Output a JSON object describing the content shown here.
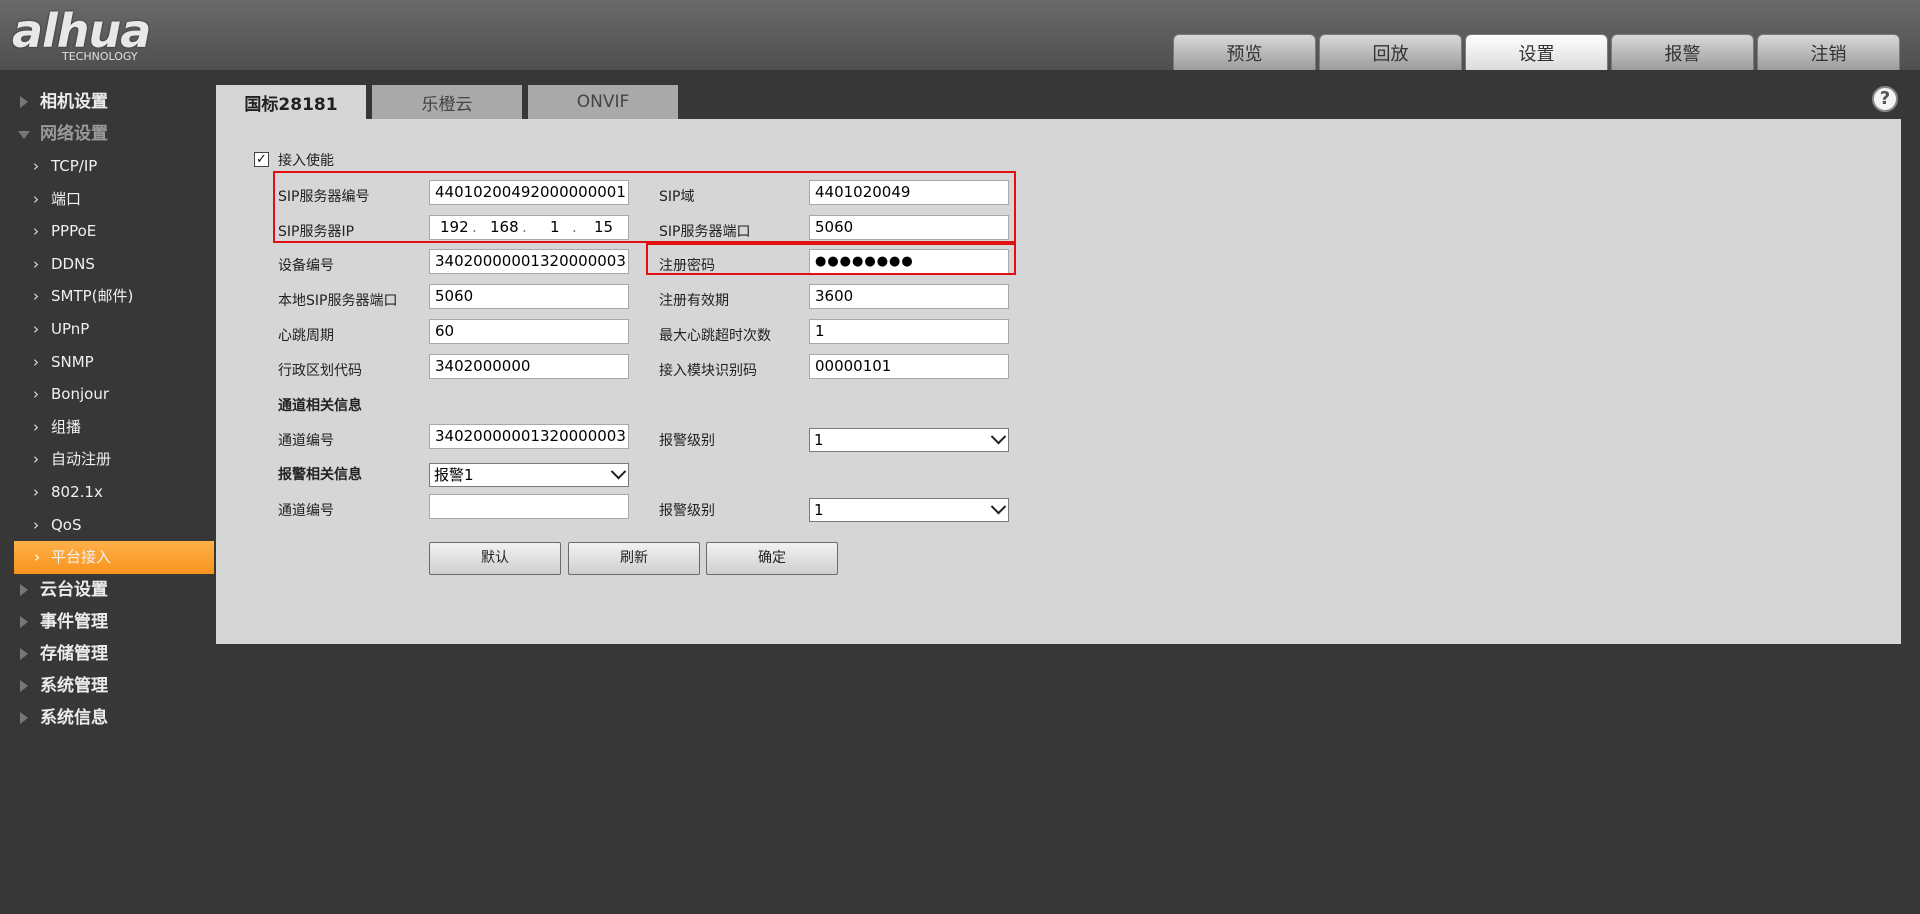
{
  "logo": {
    "main": "alhua",
    "sub": "TECHNOLOGY"
  },
  "top_nav": [
    "预览",
    "回放",
    "设置",
    "报警",
    "注销"
  ],
  "top_nav_active": "设置",
  "sidebar": {
    "groups_before": [
      {
        "label": "相机设置",
        "open": false
      },
      {
        "label": "网络设置",
        "open": true
      }
    ],
    "sub_items": [
      "TCP/IP",
      "端口",
      "PPPoE",
      "DDNS",
      "SMTP(邮件)",
      "UPnP",
      "SNMP",
      "Bonjour",
      "组播",
      "自动注册",
      "802.1x",
      "QoS",
      "平台接入"
    ],
    "active_sub": "平台接入",
    "groups_after": [
      "云台设置",
      "事件管理",
      "存储管理",
      "系统管理",
      "系统信息"
    ]
  },
  "content_tabs": [
    "国标28181",
    "乐橙云",
    "ONVIF"
  ],
  "content_tab_active": "国标28181",
  "help_icon": "?",
  "form": {
    "enable_label": "接入使能",
    "enable_checked": true,
    "check_mark": "✓",
    "sip_server_id_label": "SIP服务器编号",
    "sip_server_id": "44010200492000000001",
    "sip_domain_label": "SIP域",
    "sip_domain": "4401020049",
    "sip_server_ip_label": "SIP服务器IP",
    "sip_server_ip": [
      "192",
      "168",
      "1",
      "15"
    ],
    "ip_dot": ".",
    "sip_server_port_label": "SIP服务器端口",
    "sip_server_port": "5060",
    "device_id_label": "设备编号",
    "device_id": "34020000001320000003",
    "reg_password_label": "注册密码",
    "reg_password": "●●●●●●●●",
    "local_sip_port_label": "本地SIP服务器端口",
    "local_sip_port": "5060",
    "reg_validity_label": "注册有效期",
    "reg_validity": "3600",
    "heartbeat_label": "心跳周期",
    "heartbeat": "60",
    "max_heartbeat_timeout_label": "最大心跳超时次数",
    "max_heartbeat_timeout": "1",
    "region_code_label": "行政区划代码",
    "region_code": "3402000000",
    "module_id_label": "接入模块识别码",
    "module_id": "00000101",
    "channel_section_label": "通道相关信息",
    "channel_id_label": "通道编号",
    "channel_id": "34020000001320000003",
    "alarm_level_label": "报警级别",
    "alarm_level": "1",
    "alarm_section_label": "报警相关信息",
    "alarm_select": "报警1",
    "alarm_channel_id_label": "通道编号",
    "alarm_channel_id": "",
    "alarm_level2_label": "报警级别",
    "alarm_level2": "1"
  },
  "buttons": {
    "default": "默认",
    "refresh": "刷新",
    "confirm": "确定"
  },
  "colors": {
    "highlight_box": "#e01010",
    "active_menu": "#f7941d"
  }
}
